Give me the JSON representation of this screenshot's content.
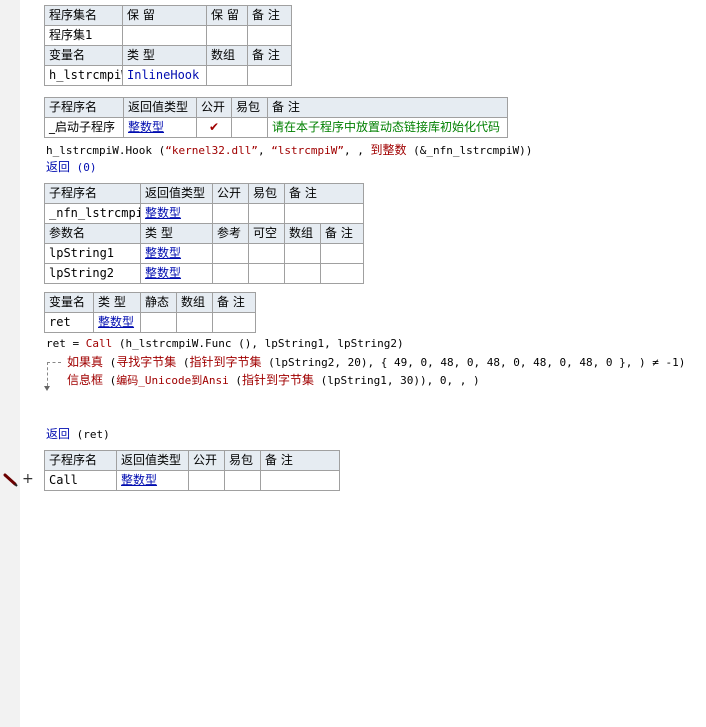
{
  "assembly_table": {
    "header": [
      "程序集名",
      "保 留",
      "保 留",
      "备 注"
    ],
    "row": [
      "程序集1",
      "",
      "",
      ""
    ],
    "var_header": [
      "变量名",
      "类 型",
      "数组",
      "备 注"
    ],
    "var_row": [
      "h_lstrcmpiW",
      "InlineHook",
      "",
      ""
    ]
  },
  "startup_sub_table": {
    "header": [
      "子程序名",
      "返回值类型",
      "公开",
      "易包",
      "备 注"
    ],
    "row": {
      "name": "_启动子程序",
      "return_type": "整数型",
      "public_mark": "✔",
      "easy": "",
      "note": "请在本子程序中放置动态链接库初始化代码"
    }
  },
  "code1": {
    "hook_obj": "h_lstrcmpiW.Hook",
    "hook_open": " (",
    "hook_arg1": "“kernel32.dll”",
    "hook_sep1": ", ",
    "hook_arg2": "“lstrcmpiW”",
    "hook_sep2": ", , ",
    "hook_fn": "到整数",
    "hook_rest": " (&_nfn_lstrcmpiW))",
    "return_kw": "返回",
    "return_arg": " (0)"
  },
  "nfn_sub_table": {
    "header": [
      "子程序名",
      "返回值类型",
      "公开",
      "易包",
      "备 注"
    ],
    "row": [
      "_nfn_lstrcmpiW",
      "整数型",
      "",
      "",
      ""
    ],
    "param_header": [
      "参数名",
      "类 型",
      "参考",
      "可空",
      "数组",
      "备 注"
    ],
    "params": [
      [
        "lpString1",
        "整数型",
        "",
        "",
        "",
        ""
      ],
      [
        "lpString2",
        "整数型",
        "",
        "",
        "",
        ""
      ]
    ]
  },
  "local_var_table": {
    "header": [
      "变量名",
      "类 型",
      "静态",
      "数组",
      "备 注"
    ],
    "row": [
      "ret",
      "整数型",
      "",
      "",
      ""
    ]
  },
  "code2": {
    "ret_assign": "ret = ",
    "call_fn": "Call",
    "call_args": " (h_lstrcmpiW.Func (), lpString1, lpString2)",
    "if_kw": "如果真",
    "if_open": " (",
    "find_fn": "寻找字节集",
    "find_open": " (",
    "ptr_fn1": "指针到字节集",
    "if_rest": " (lpString2, 20), { 49, 0, 48, 0, 48, 0, 48, 0, 48, 0 }, ) ≠ -1)",
    "msg_fn": "信息框",
    "msg_open": " (",
    "enc_fn": "编码_Unicode到Ansi",
    "enc_open": " (",
    "ptr_fn2": "指针到字节集",
    "msg_rest": " (lpString1, 30)), 0, , )",
    "return_kw": "返回",
    "return_arg": " (ret)"
  },
  "call_sub_table": {
    "header": [
      "子程序名",
      "返回值类型",
      "公开",
      "易包",
      "备 注"
    ],
    "row": [
      "Call",
      "整数型",
      "",
      "",
      ""
    ]
  },
  "margin": {
    "pen_icon": "pencil-icon",
    "plus": "+"
  }
}
